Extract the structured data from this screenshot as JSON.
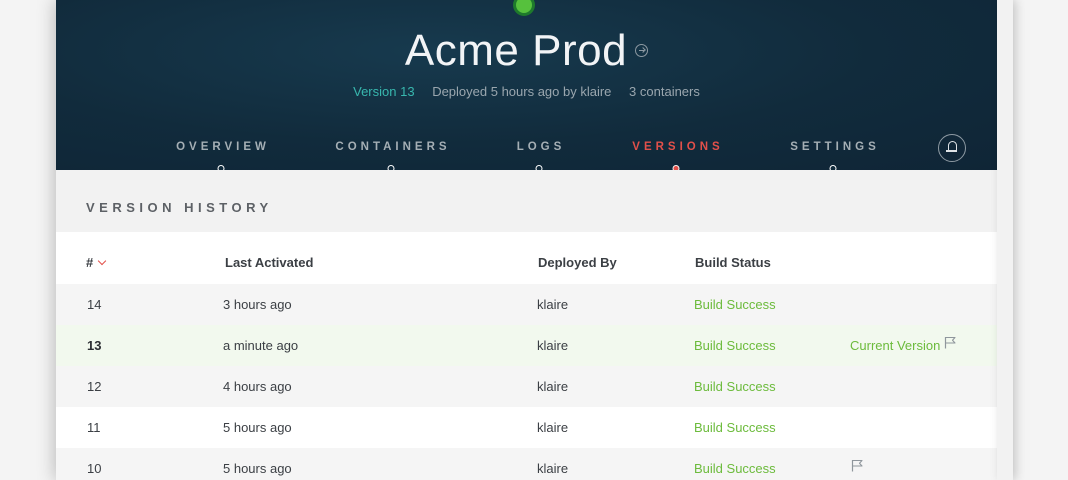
{
  "app": {
    "title": "Acme Prod",
    "version_link": "Version 13",
    "deployed_text": "Deployed 5 hours ago by klaire",
    "containers_text": "3 containers"
  },
  "nav": {
    "tabs": [
      {
        "label": "OVERVIEW",
        "active": false
      },
      {
        "label": "CONTAINERS",
        "active": false
      },
      {
        "label": "LOGS",
        "active": false
      },
      {
        "label": "VERSIONS",
        "active": true
      },
      {
        "label": "SETTINGS",
        "active": false
      }
    ]
  },
  "section": {
    "title": "VERSION HISTORY"
  },
  "table": {
    "headers": {
      "number": "#",
      "last_activated": "Last Activated",
      "deployed_by": "Deployed By",
      "build_status": "Build Status"
    },
    "rows": [
      {
        "number": "14",
        "last_activated": "3 hours ago",
        "deployed_by": "klaire",
        "build_status": "Build Success",
        "note": "",
        "flag": false
      },
      {
        "number": "13",
        "last_activated": "a minute ago",
        "deployed_by": "klaire",
        "build_status": "Build Success",
        "note": "Current Version",
        "flag": true
      },
      {
        "number": "12",
        "last_activated": "4 hours ago",
        "deployed_by": "klaire",
        "build_status": "Build Success",
        "note": "",
        "flag": false
      },
      {
        "number": "11",
        "last_activated": "5 hours ago",
        "deployed_by": "klaire",
        "build_status": "Build Success",
        "note": "",
        "flag": false
      },
      {
        "number": "10",
        "last_activated": "5 hours ago",
        "deployed_by": "klaire",
        "build_status": "Build Success",
        "note": "",
        "flag": true
      }
    ]
  },
  "colors": {
    "header_bg": "#112b3c",
    "accent_red": "#e2504a",
    "success_green": "#6cbb3c",
    "link_teal": "#38b7ae",
    "status_dot": "#56c13d"
  },
  "icons": {
    "status": "status-dot-icon",
    "title_link": "arrow-circle-right-icon",
    "notifications": "bell-icon",
    "sort": "chevron-down-icon",
    "flag": "flag-icon"
  }
}
